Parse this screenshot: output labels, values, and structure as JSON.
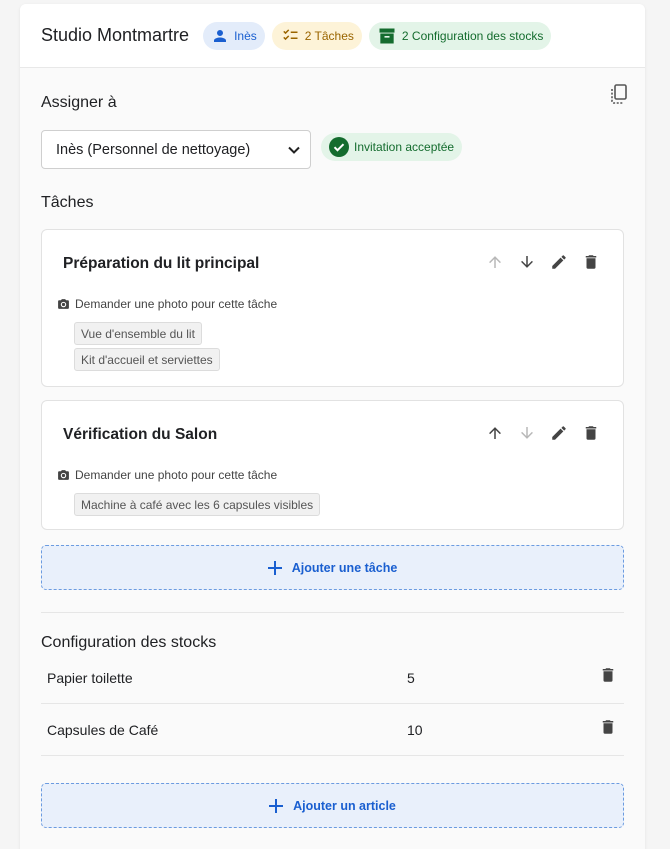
{
  "header": {
    "title": "Studio Montmartre",
    "chips": {
      "person": {
        "label": "Inès",
        "icon": "person-icon"
      },
      "tasks": {
        "label": "2 Tâches",
        "icon": "checklist-icon"
      },
      "stock": {
        "label": "2 Configuration des stocks",
        "icon": "archive-icon"
      }
    }
  },
  "assign": {
    "title": "Assigner à",
    "selected": "Inès (Personnel de nettoyage)",
    "status": "Invitation acceptée"
  },
  "tasks": {
    "title": "Tâches",
    "items": [
      {
        "title": "Préparation du lit principal",
        "photo_label": "Demander une photo pour cette tâche",
        "tags": [
          "Vue d'ensemble du lit",
          "Kit d'accueil et serviettes"
        ]
      },
      {
        "title": "Vérification du Salon",
        "photo_label": "Demander une photo pour cette tâche",
        "tags": [
          "Machine à café avec les 6 capsules visibles"
        ]
      }
    ],
    "add_label": "Ajouter une tâche"
  },
  "stock": {
    "title": "Configuration des stocks",
    "items": [
      {
        "name": "Papier toilette",
        "qty": "5"
      },
      {
        "name": "Capsules de Café",
        "qty": "10"
      }
    ],
    "add_label": "Ajouter un article"
  },
  "colors": {
    "accent": "#1a5fd0",
    "success": "#146c2e",
    "warning": "#9a6500"
  }
}
